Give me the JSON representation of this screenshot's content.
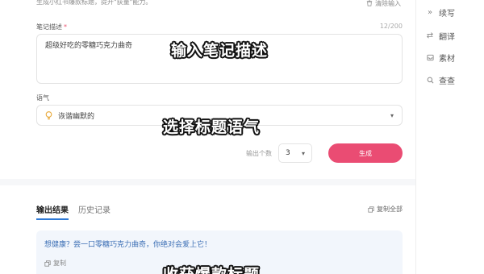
{
  "header": {
    "subtitle": "生成小红书爆款标题，提升\"获量\"能力。",
    "clear_label": "清除输入"
  },
  "note_field": {
    "label": "笔记描述",
    "required_mark": "*",
    "counter": "12/200",
    "value": "超级好吃的零糖巧克力曲奇"
  },
  "tone_field": {
    "label": "语气",
    "value": "诙谐幽默的"
  },
  "generate": {
    "count_label": "输出个数",
    "count_value": "3",
    "button_label": "生成"
  },
  "results": {
    "tabs": [
      {
        "label": "输出结果",
        "active": true
      },
      {
        "label": "历史记录",
        "active": false
      }
    ],
    "copy_all_label": "复制全部",
    "items": [
      {
        "text": "想健康？尝一口零糖巧克力曲奇，你绝对会爱上它！",
        "copy_label": "复制"
      }
    ]
  },
  "sidebar": {
    "items": [
      {
        "label": "续写",
        "icon": "double-chevron-right-icon"
      },
      {
        "label": "翻译",
        "icon": "swap-arrows-icon"
      },
      {
        "label": "素材",
        "icon": "inbox-icon"
      },
      {
        "label": "查查",
        "icon": "search-icon"
      }
    ]
  },
  "captions": [
    "输入笔记描述",
    "选择标题语气",
    "收获爆款标题"
  ],
  "colors": {
    "accent": "#ea4c73",
    "tab_underline": "#2f7ad6",
    "result_text": "#3c6fb5",
    "result_bg": "#f2f6fc"
  }
}
